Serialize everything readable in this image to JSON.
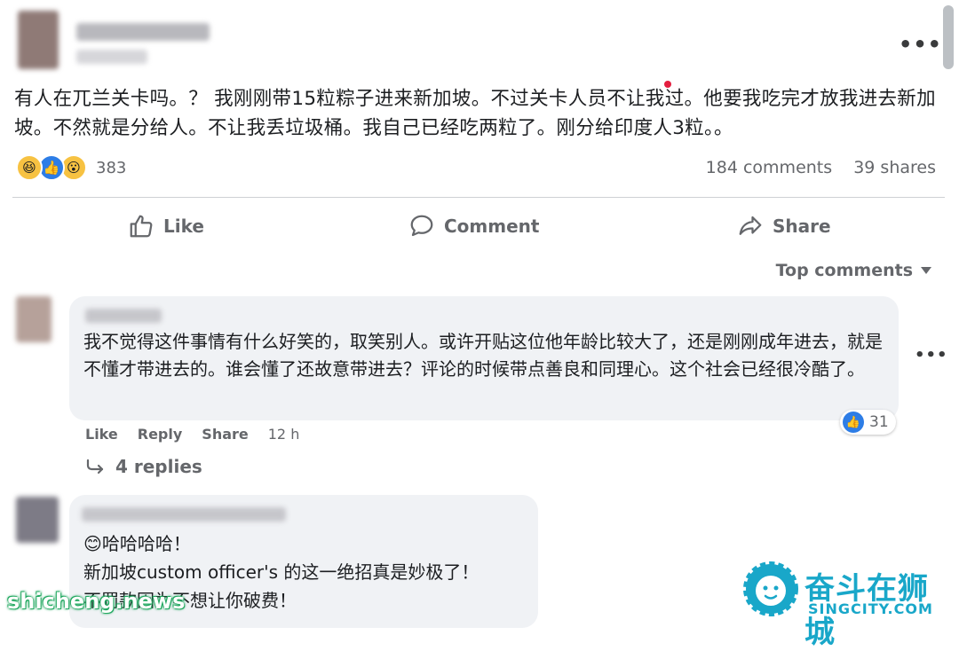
{
  "post": {
    "text": "有人在兀兰关卡吗。？ 我刚刚带15粒粽子进来新加坡。不过关卡人员不让我过。他要我吃完才放我进去新加坡。不然就是分给人。不让我丢垃圾桶。我自己已经吃两粒了。刚分给印度人3粒。。",
    "more_label": "•••",
    "reaction_count": "383",
    "comments_count": "184 comments",
    "shares_count": "39 shares"
  },
  "actions": {
    "like": "Like",
    "comment": "Comment",
    "share": "Share"
  },
  "sort_label": "Top comments",
  "comments": [
    {
      "text": "我不觉得这件事情有什么好笑的，取笑别人。或许开贴这位他年龄比较大了，还是刚刚成年进去，就是不懂才带进去的。谁会懂了还故意带进去？评论的时候带点善良和同理心。这个社会已经很冷酷了。",
      "like_label": "Like",
      "reply_label": "Reply",
      "share_label": "Share",
      "time": "12 h",
      "reaction_count": "31",
      "replies": "4 replies",
      "more_label": "•••"
    },
    {
      "line1": "😊哈哈哈哈！",
      "line2": "新加坡custom officer's 的这一绝招真是妙极了！",
      "line3": "不罚款因为不想让你破费！"
    }
  ],
  "watermarks": {
    "left": "shicheng.news",
    "right_title": "奋斗在狮城",
    "right_sub": "SINGCITY.COM"
  },
  "colors": {
    "like_blue": "#2d7de6",
    "haha_yellow": "#f7c242",
    "secondary_text": "#65676b",
    "bubble_bg": "#f0f2f5",
    "watermark_blue": "#19a7c9",
    "watermark_green": "#22a860"
  }
}
